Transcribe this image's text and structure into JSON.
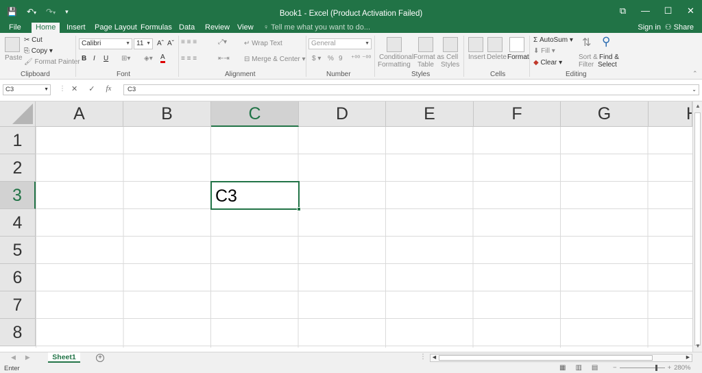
{
  "window": {
    "title": "Book1 - Excel (Product Activation Failed)",
    "controls": {
      "ribbon_display": "⧉",
      "minimize": "—",
      "maximize": "☐",
      "close": "✕"
    }
  },
  "qat": {
    "save": "💾",
    "undo": "↶",
    "undo_dd": "▾",
    "redo": "↷",
    "redo_dd": "▾",
    "customize": "▾"
  },
  "tabs": [
    "File",
    "Home",
    "Insert",
    "Page Layout",
    "Formulas",
    "Data",
    "Review",
    "View"
  ],
  "active_tab": "Home",
  "tell_me": "Tell me what you want to do...",
  "account": {
    "sign_in": "Sign in",
    "share": "Share"
  },
  "ribbon": {
    "clipboard": {
      "label": "Clipboard",
      "paste": "Paste",
      "cut": "Cut",
      "copy": "Copy",
      "format_painter": "Format Painter"
    },
    "font": {
      "label": "Font",
      "name": "Calibri",
      "size": "11",
      "grow": "A",
      "shrink": "A",
      "bold": "B",
      "italic": "I",
      "underline": "U"
    },
    "alignment": {
      "label": "Alignment",
      "wrap_text": "Wrap Text",
      "merge_center": "Merge & Center"
    },
    "number": {
      "label": "Number",
      "format": "General",
      "currency": "$",
      "percent": "%",
      "comma": "9"
    },
    "styles": {
      "label": "Styles",
      "conditional_1": "Conditional",
      "conditional_2": "Formatting",
      "format_table_1": "Format as",
      "format_table_2": "Table",
      "cell_styles_1": "Cell",
      "cell_styles_2": "Styles"
    },
    "cells": {
      "label": "Cells",
      "insert": "Insert",
      "delete": "Delete",
      "format": "Format"
    },
    "editing": {
      "label": "Editing",
      "autosum": "AutoSum",
      "fill": "Fill",
      "clear": "Clear",
      "sort_1": "Sort &",
      "sort_2": "Filter",
      "find_1": "Find &",
      "find_2": "Select"
    }
  },
  "formula_bar": {
    "name_box": "C3",
    "cancel": "✕",
    "enter": "✓",
    "fx": "fx",
    "content": "C3"
  },
  "columns": [
    "A",
    "B",
    "C",
    "D",
    "E",
    "F",
    "G",
    "H"
  ],
  "rows": [
    "1",
    "2",
    "3",
    "4",
    "5",
    "6",
    "7",
    "8"
  ],
  "active_cell": {
    "ref": "C3",
    "value": "C3"
  },
  "sheets": [
    "Sheet1"
  ],
  "status": {
    "mode": "Enter",
    "zoom": "280%"
  }
}
